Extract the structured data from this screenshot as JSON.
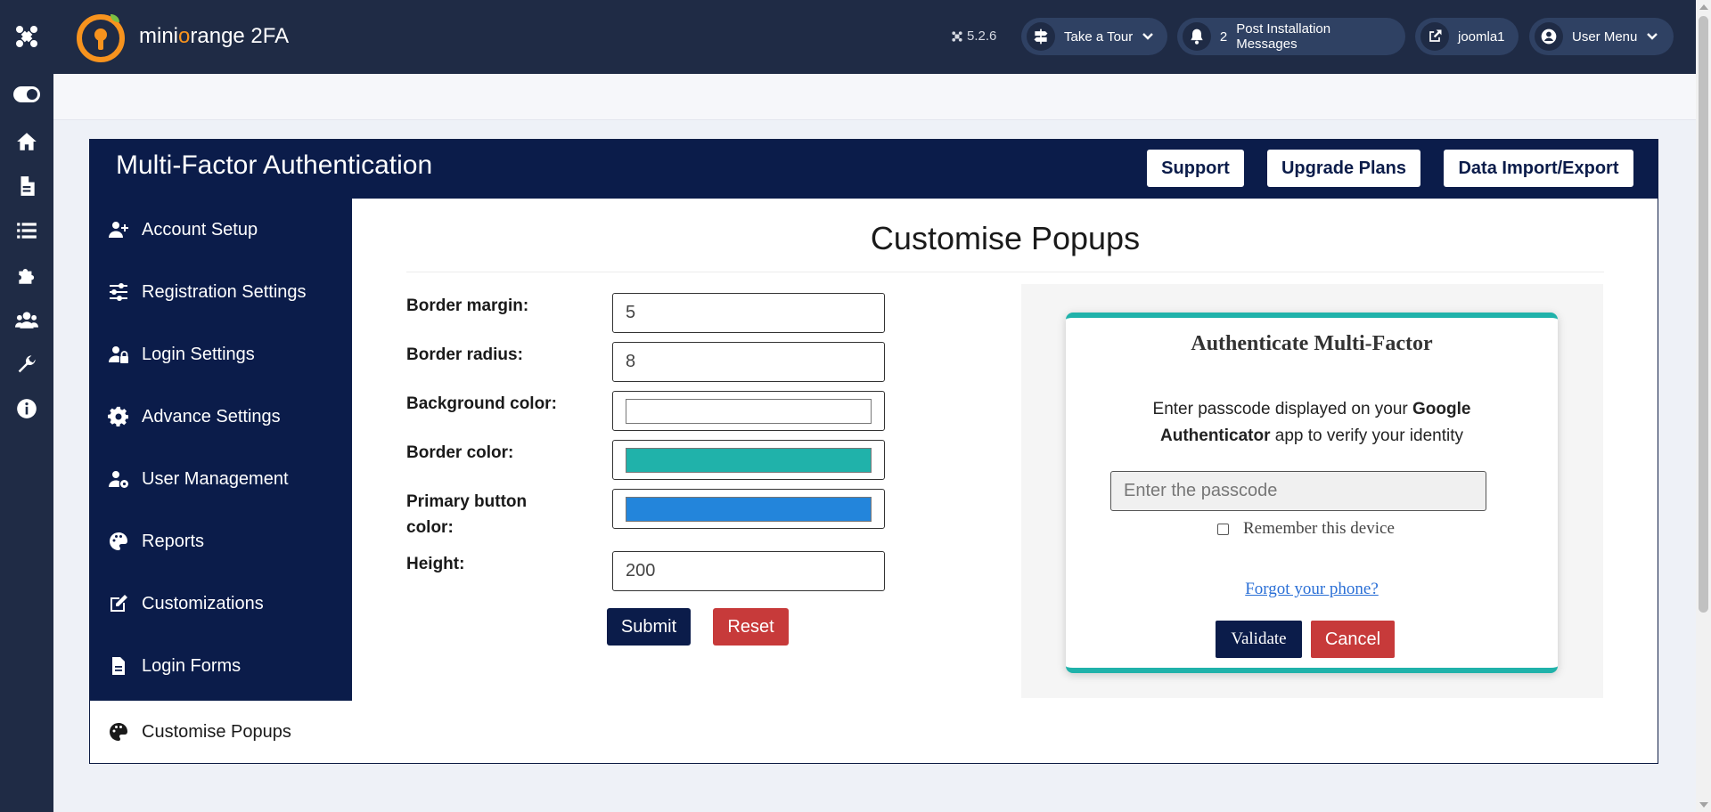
{
  "header": {
    "app_name_prefix": "mini",
    "app_name_o": "o",
    "app_name_suffix": "range 2FA",
    "version": "5.2.6",
    "take_tour": "Take a Tour",
    "notification_count": "2",
    "post_install": "Post Installation Messages",
    "site_link": "joomla1",
    "user_menu": "User Menu"
  },
  "card": {
    "title": "Multi-Factor Authentication",
    "buttons": {
      "support": "Support",
      "upgrade": "Upgrade Plans",
      "data": "Data Import/Export"
    }
  },
  "sidebar": {
    "items": [
      {
        "label": "Account Setup",
        "icon": "user-plus-icon"
      },
      {
        "label": "Registration Settings",
        "icon": "sliders-icon"
      },
      {
        "label": "Login Settings",
        "icon": "user-lock-icon"
      },
      {
        "label": "Advance Settings",
        "icon": "gear-icon"
      },
      {
        "label": "User Management",
        "icon": "user-gear-icon"
      },
      {
        "label": "Reports",
        "icon": "palette-icon"
      },
      {
        "label": "Customizations",
        "icon": "edit-icon"
      },
      {
        "label": "Login Forms",
        "icon": "file-icon"
      },
      {
        "label": "Customise Popups",
        "icon": "palette-icon",
        "active": true
      }
    ]
  },
  "form": {
    "title": "Customise Popups",
    "border_margin_label": "Border margin:",
    "border_margin_value": "5",
    "border_radius_label": "Border radius:",
    "border_radius_value": "8",
    "bg_color_label": "Background color:",
    "bg_color_value": "#ffffff",
    "border_color_label": "Border color:",
    "border_color_value": "#20b2aa",
    "primary_btn_label": "Primary button color:",
    "primary_btn_value": "#2385db",
    "height_label": "Height:",
    "height_value": "200",
    "submit": "Submit",
    "reset": "Reset"
  },
  "preview": {
    "title": "Authenticate Multi-Factor",
    "msg_part1": "Enter passcode displayed on your ",
    "msg_bold1": "Google Authenticator",
    "msg_part2": " app to verify your identity",
    "input_placeholder": "Enter the passcode",
    "remember": "Remember this device",
    "forgot": "Forgot your phone?",
    "validate": "Validate",
    "cancel": "Cancel"
  },
  "colors": {
    "navy": "#0b1c4a",
    "header": "#1f2b45",
    "danger": "#c73a3a",
    "teal": "#20b2aa",
    "accent_orange": "#f7931e"
  }
}
